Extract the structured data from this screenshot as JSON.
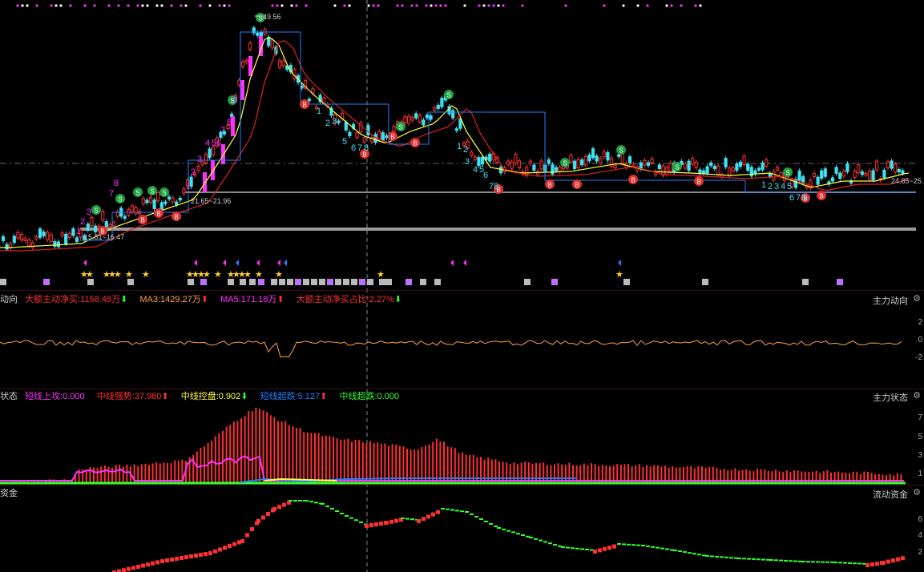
{
  "colors": {
    "up": "#ff3030",
    "down": "#40e0f0",
    "magenta": "#ff30ff",
    "yellow": "#ffff40",
    "blue": "#2080ff",
    "green": "#30ff30",
    "orange": "#ffa040",
    "grid": "#3a1010"
  },
  "main": {
    "high_label": "49.56",
    "levels": [
      {
        "label": "15.81~16.47"
      },
      {
        "label": "21.65~21.96"
      },
      {
        "label": "24.85~25."
      }
    ]
  },
  "panel1": {
    "title": "主力动向",
    "left_cut": "动向",
    "items": [
      {
        "label": "大额主动净买:1158.48万",
        "arrow": "down",
        "color": "#ff3030"
      },
      {
        "label": "MA3:1429.27万",
        "arrow": "up",
        "color": "#ffa040"
      },
      {
        "label": "MA5:171.18万",
        "arrow": "up",
        "color": "#ff30ff"
      },
      {
        "label": "大额主动净买占比:2.27%",
        "arrow": "down",
        "color": "#ff3030"
      }
    ],
    "y_ticks": [
      "2",
      "0",
      "-2"
    ]
  },
  "panel2": {
    "title": "主力状态",
    "left_cut": "状态",
    "items": [
      {
        "label": "短线上攻:0.000",
        "color": "#ff30ff"
      },
      {
        "label": "中线强势:37.980",
        "arrow": "up",
        "color": "#ff3030"
      },
      {
        "label": "中线控盘:0.902",
        "arrow": "down",
        "color": "#ffff40"
      },
      {
        "label": "短线超跌:5.127",
        "arrow": "up",
        "color": "#2080ff"
      },
      {
        "label": "中线超跌:0.000",
        "color": "#30ff30"
      }
    ],
    "y_ticks": [
      "7",
      "5",
      "3",
      "1"
    ]
  },
  "panel3": {
    "title": "流动资金",
    "left_cut": "资金",
    "y_ticks": [
      "6",
      "4",
      "2"
    ]
  },
  "arrows": {
    "up": "⬆",
    "down": "⬇"
  }
}
